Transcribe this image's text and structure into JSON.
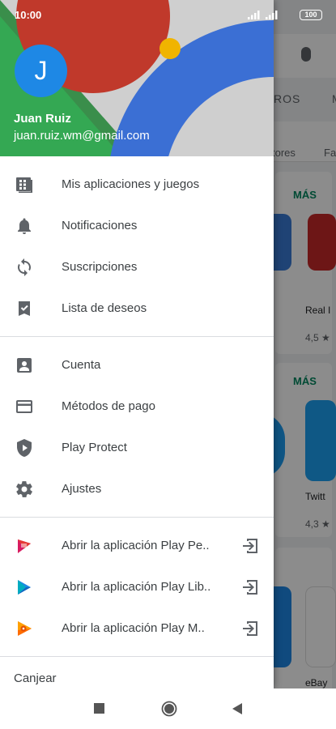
{
  "status_bar": {
    "time": "10:00",
    "battery": "100"
  },
  "user": {
    "initial": "J",
    "name": "Juan Ruiz",
    "email": "juan.ruiz.wm@gmail.com"
  },
  "menu": {
    "group1": [
      {
        "label": "Mis aplicaciones y juegos",
        "icon": "apps-grid-icon"
      },
      {
        "label": "Notificaciones",
        "icon": "bell-icon"
      },
      {
        "label": "Suscripciones",
        "icon": "refresh-icon"
      },
      {
        "label": "Lista de deseos",
        "icon": "bookmark-check-icon"
      }
    ],
    "group2": [
      {
        "label": "Cuenta",
        "icon": "account-box-icon"
      },
      {
        "label": "Métodos de pago",
        "icon": "credit-card-icon"
      },
      {
        "label": "Play Protect",
        "icon": "shield-play-icon"
      },
      {
        "label": "Ajustes",
        "icon": "gear-icon"
      }
    ],
    "group3": [
      {
        "label": "Abrir la aplicación Play Pe..",
        "icon": "play-movies-icon"
      },
      {
        "label": "Abrir la aplicación Play Lib..",
        "icon": "play-books-icon"
      },
      {
        "label": "Abrir la aplicación Play M..",
        "icon": "play-music-icon"
      }
    ],
    "redeem": "Canjear"
  },
  "background": {
    "tab": "ROS",
    "tab2": "M",
    "chip": "tores",
    "chip2": "Fa",
    "more1": "MÁS",
    "more2": "MÁS",
    "app1": "Real I",
    "rating1": "4,5 ★",
    "app2": "Twitt",
    "rating2": "4,3 ★",
    "app3": "eBay"
  },
  "colors": {
    "accent": "#01875f",
    "avatar": "#1e88e5"
  }
}
